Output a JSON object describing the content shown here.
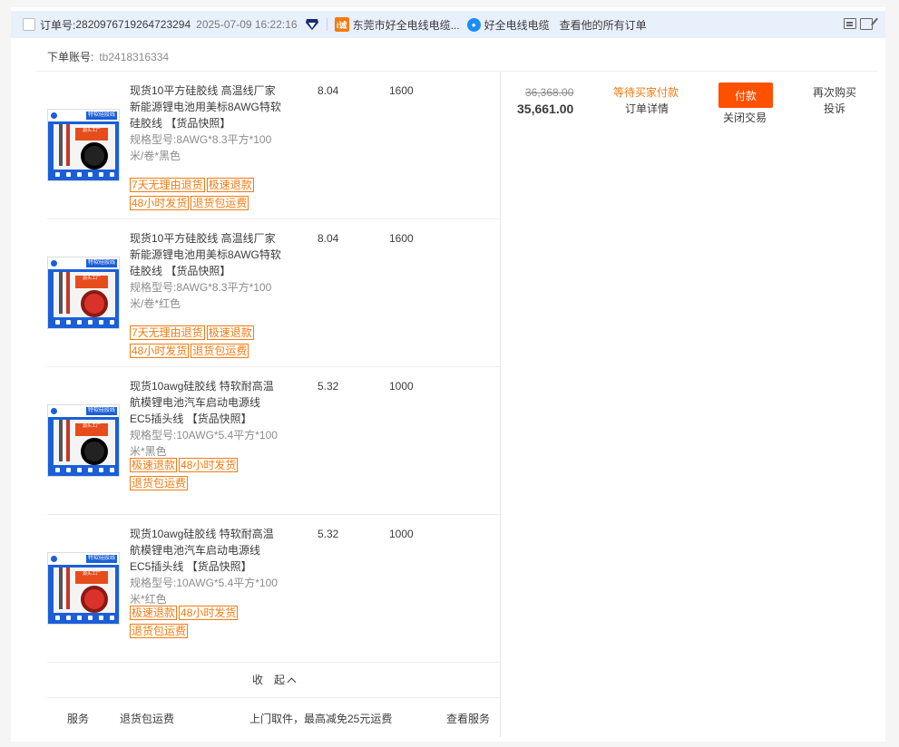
{
  "header": {
    "order_label": "订单号:",
    "order_no": "2820976719264723294",
    "date": "2025-07-09 16:22:16",
    "shop_name": "东莞市好全电线电缆...",
    "shop_icon_text": "i诚",
    "seller_name": "好全电线电缆",
    "all_orders": "查看他的所有订单"
  },
  "account": {
    "label": "下单账号:",
    "value": "tb2418316334"
  },
  "items": [
    {
      "title": "现货10平方硅胶线 高温线厂家新能源锂电池用美标8AWG特软硅胶线 【货品快照】",
      "spec": "规格型号:8AWG*8.3平方*100米/卷*黑色",
      "price": "8.04",
      "qty": "1600",
      "tags": [
        "7天无理由退货",
        "极速退款",
        "48小时发货",
        "退货包运费"
      ],
      "coil": "black"
    },
    {
      "title": "现货10平方硅胶线 高温线厂家新能源锂电池用美标8AWG特软硅胶线 【货品快照】",
      "spec": "规格型号:8AWG*8.3平方*100米/卷*红色",
      "price": "8.04",
      "qty": "1600",
      "tags": [
        "7天无理由退货",
        "极速退款",
        "48小时发货",
        "退货包运费"
      ],
      "coil": "red"
    },
    {
      "title": "现货10awg硅胶线 特软耐高温航模锂电池汽车启动电源线 EC5插头线 【货品快照】",
      "spec": "规格型号:10AWG*5.4平方*100米*黑色",
      "price": "5.32",
      "qty": "1000",
      "tags": [
        "极速退款",
        "48小时发货",
        "退货包运费"
      ],
      "coil": "black"
    },
    {
      "title": "现货10awg硅胶线 特软耐高温航模锂电池汽车启动电源线 EC5插头线 【货品快照】",
      "spec": "规格型号:10AWG*5.4平方*100米*红色",
      "price": "5.32",
      "qty": "1000",
      "tags": [
        "极速退款",
        "48小时发货",
        "退货包运费"
      ],
      "coil": "red"
    }
  ],
  "collapse_label": "收　起",
  "service": {
    "label": "服务",
    "name": "退货包运费",
    "desc": "上门取件，最高减免25元运费",
    "link": "查看服务"
  },
  "summary": {
    "original_price": "36,368.00",
    "total": "35,661.00",
    "status": "等待买家付款",
    "detail": "订单详情",
    "pay": "付款",
    "close": "关闭交易",
    "rebuy": "再次购买",
    "complain": "投诉"
  },
  "colors": {
    "accent": "#ff5000",
    "tag": "#f27b12",
    "header_bg": "#e8f0fc"
  }
}
